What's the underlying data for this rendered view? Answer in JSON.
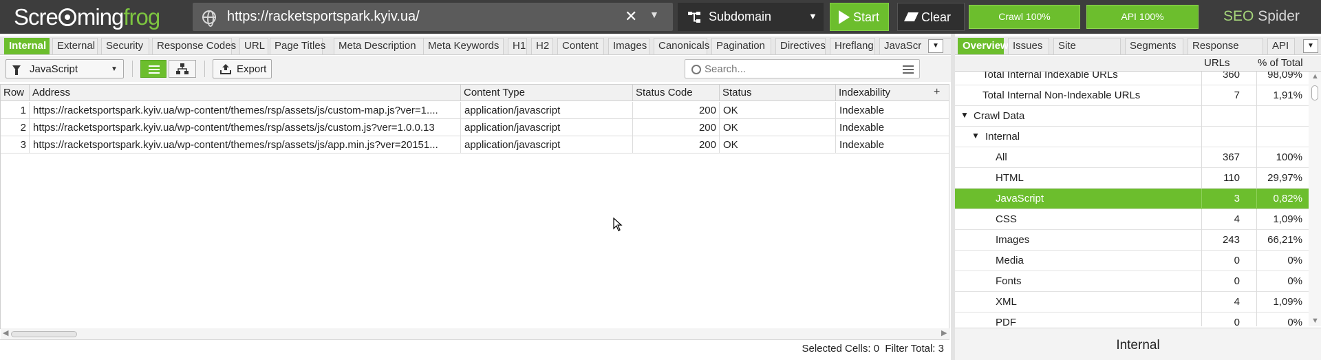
{
  "app": {
    "logo_left": "Scre",
    "logo_mid": "ming",
    "logo_right": "frog",
    "product_prefix": "SEO",
    "product_suffix": "Spider"
  },
  "topbar": {
    "url_value": "https://racketsportspark.kyiv.ua/",
    "mode_label": "Subdomain",
    "start_label": "Start",
    "clear_label": "Clear",
    "crawl_progress": "Crawl 100%",
    "api_progress": "API 100%",
    "crawl_progress_fraction": 1.0,
    "api_progress_fraction": 1.0
  },
  "left_tabs": [
    {
      "label": "Internal",
      "active": true
    },
    {
      "label": "External"
    },
    {
      "label": "Security"
    },
    {
      "label": "Response Codes"
    },
    {
      "label": "URL"
    },
    {
      "label": "Page Titles"
    },
    {
      "label": "Meta Description"
    },
    {
      "label": "Meta Keywords"
    },
    {
      "label": "H1"
    },
    {
      "label": "H2"
    },
    {
      "label": "Content"
    },
    {
      "label": "Images"
    },
    {
      "label": "Canonicals"
    },
    {
      "label": "Pagination"
    },
    {
      "label": "Directives"
    },
    {
      "label": "Hreflang"
    },
    {
      "label": "JavaScr"
    }
  ],
  "toolbar": {
    "filter_value": "JavaScript",
    "export_label": "Export",
    "search_placeholder": "Search..."
  },
  "grid": {
    "columns": [
      "Row",
      "Address",
      "Content Type",
      "Status Code",
      "Status",
      "Indexability"
    ],
    "rows": [
      {
        "row": "1",
        "address": "https://racketsportspark.kyiv.ua/wp-content/themes/rsp/assets/js/custom-map.js?ver=1....",
        "content_type": "application/javascript",
        "status_code": "200",
        "status": "OK",
        "indexability": "Indexable"
      },
      {
        "row": "2",
        "address": "https://racketsportspark.kyiv.ua/wp-content/themes/rsp/assets/js/custom.js?ver=1.0.0.13",
        "content_type": "application/javascript",
        "status_code": "200",
        "status": "OK",
        "indexability": "Indexable"
      },
      {
        "row": "3",
        "address": "https://racketsportspark.kyiv.ua/wp-content/themes/rsp/assets/js/app.min.js?ver=20151...",
        "content_type": "application/javascript",
        "status_code": "200",
        "status": "OK",
        "indexability": "Indexable"
      }
    ]
  },
  "statusbar": {
    "selected_label": "Selected Cells:",
    "selected_value": "0",
    "filter_label": "Filter Total:",
    "filter_value": "3"
  },
  "right_tabs": [
    {
      "label": "Overview",
      "active": true
    },
    {
      "label": "Issues"
    },
    {
      "label": "Site Structure"
    },
    {
      "label": "Segments"
    },
    {
      "label": "Response Times"
    },
    {
      "label": "API"
    }
  ],
  "overview": {
    "col_urls": "URLs",
    "col_pct": "% of Total",
    "rows": [
      {
        "label": "Total Internal Indexable URLs",
        "count": "360",
        "pct": "98,09%",
        "indent": 0,
        "caret": ""
      },
      {
        "label": "Total Internal Non-Indexable URLs",
        "count": "7",
        "pct": "1,91%",
        "indent": 0,
        "caret": ""
      },
      {
        "label": "Crawl Data",
        "count": "",
        "pct": "",
        "indent": 0,
        "caret": "▼"
      },
      {
        "label": "Internal",
        "count": "",
        "pct": "",
        "indent": 1,
        "caret": "▼"
      },
      {
        "label": "All",
        "count": "367",
        "pct": "100%",
        "indent": 2,
        "caret": ""
      },
      {
        "label": "HTML",
        "count": "110",
        "pct": "29,97%",
        "indent": 2,
        "caret": ""
      },
      {
        "label": "JavaScript",
        "count": "3",
        "pct": "0,82%",
        "indent": 2,
        "caret": "",
        "selected": true
      },
      {
        "label": "CSS",
        "count": "4",
        "pct": "1,09%",
        "indent": 2,
        "caret": ""
      },
      {
        "label": "Images",
        "count": "243",
        "pct": "66,21%",
        "indent": 2,
        "caret": ""
      },
      {
        "label": "Media",
        "count": "0",
        "pct": "0%",
        "indent": 2,
        "caret": ""
      },
      {
        "label": "Fonts",
        "count": "0",
        "pct": "0%",
        "indent": 2,
        "caret": ""
      },
      {
        "label": "XML",
        "count": "4",
        "pct": "1,09%",
        "indent": 2,
        "caret": ""
      },
      {
        "label": "PDF",
        "count": "0",
        "pct": "0%",
        "indent": 2,
        "caret": ""
      }
    ],
    "footer_label": "Internal"
  },
  "colors": {
    "accent": "#6cbe2d",
    "topbar": "#3d3d3d"
  }
}
